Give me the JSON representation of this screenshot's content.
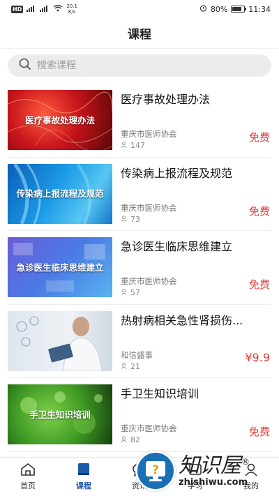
{
  "status_bar": {
    "hd": "HD",
    "net_speed": "20.1",
    "net_unit": "K/s",
    "alarm_icon": "alarm-icon",
    "battery_pct": "80%",
    "battery_level": 0.8,
    "time": "11:34"
  },
  "header": {
    "title": "课程"
  },
  "search": {
    "placeholder": "搜索课程"
  },
  "courses": [
    {
      "title": "医疗事故处理办法",
      "thumb_caption": "医疗事故处理办法",
      "org": "重庆市医师协会",
      "views": "147",
      "price": "免费"
    },
    {
      "title": "传染病上报流程及规范",
      "thumb_caption": "传染病上报流程及规范",
      "org": "重庆市医师协会",
      "views": "73",
      "price": "免费"
    },
    {
      "title": "急诊医生临床思维建立",
      "thumb_caption": "急诊医生临床思维建立",
      "org": "重庆市医师协会",
      "views": "57",
      "price": "免费"
    },
    {
      "title": "热射病相关急性肾损伤...",
      "thumb_caption": "",
      "org": "和信盛事",
      "views": "21",
      "price": "¥9.9"
    },
    {
      "title": "手卫生知识培训",
      "thumb_caption": "手卫生知识培训",
      "org": "重庆市医师协会",
      "views": "82",
      "price": "免费"
    }
  ],
  "tabbar": {
    "tabs": [
      {
        "label": "首页"
      },
      {
        "label": "课程"
      },
      {
        "label": "资讯"
      },
      {
        "label": "学习"
      },
      {
        "label": "我的"
      }
    ]
  },
  "watermark": {
    "brand": "知识屋",
    "domain": "zhishiwu.com",
    "registered": "®"
  },
  "colors": {
    "accent": "#1e5aa8",
    "price": "#e23b3b"
  }
}
